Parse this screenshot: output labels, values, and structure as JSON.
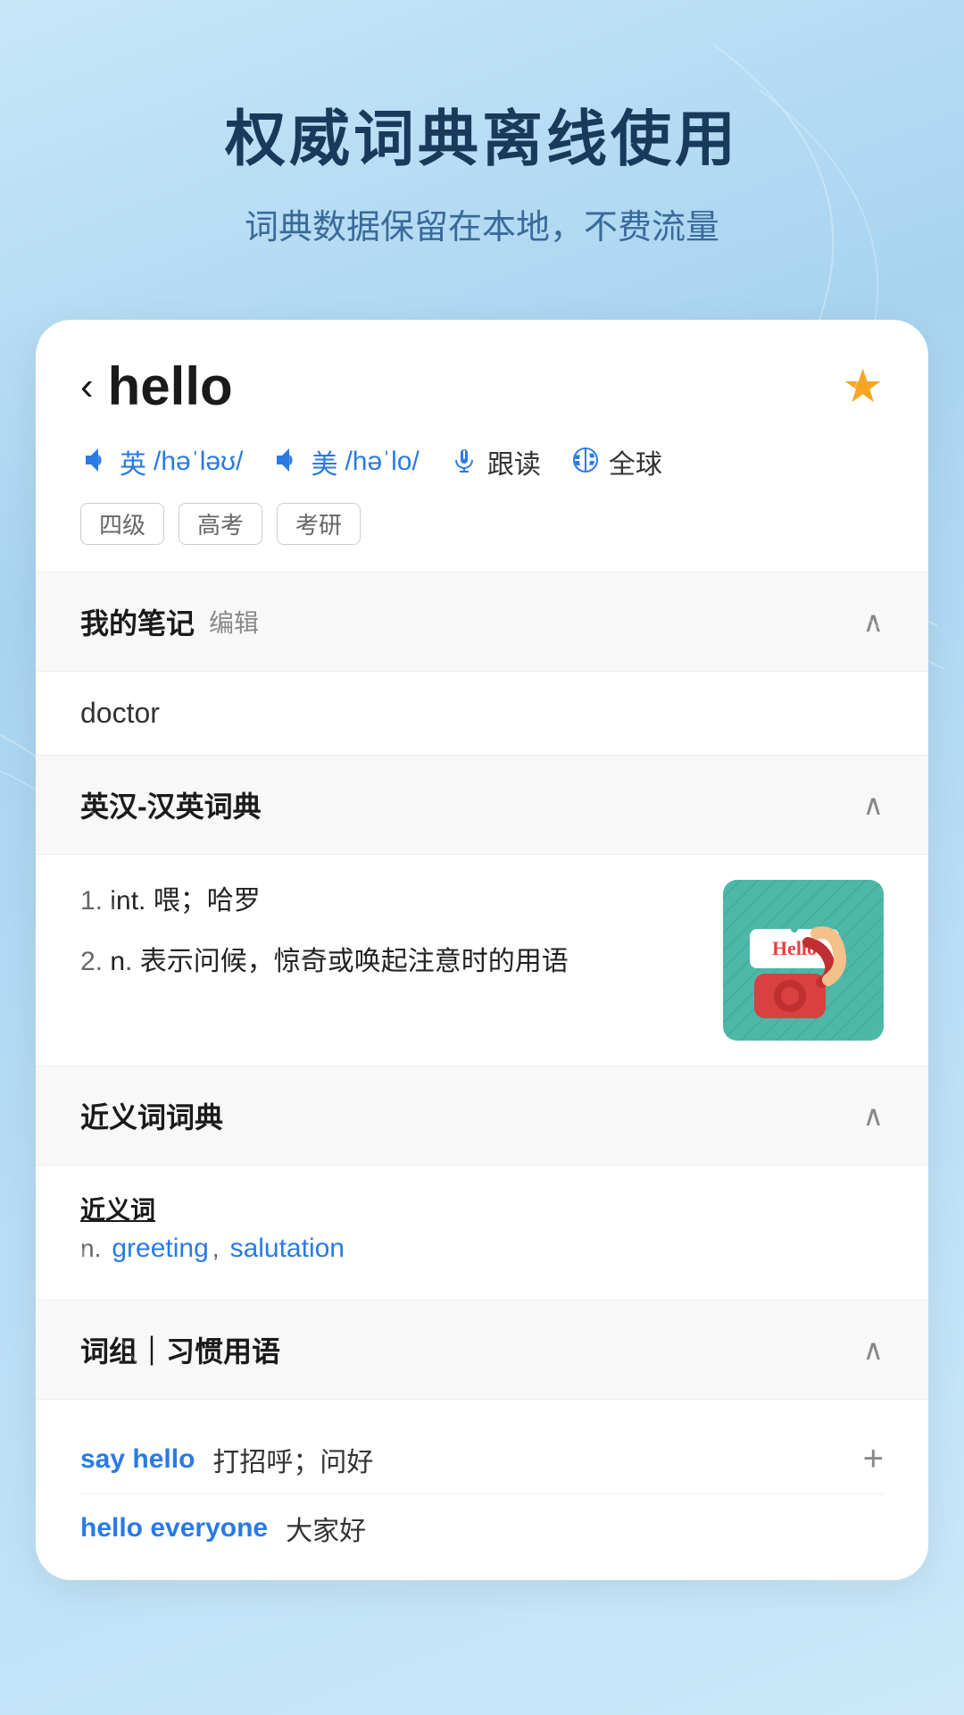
{
  "background": {
    "color": "#b8ddf5"
  },
  "top_section": {
    "main_title": "权威词典离线使用",
    "sub_title": "词典数据保留在本地，不费流量"
  },
  "word_header": {
    "back_arrow": "‹",
    "word": "hello",
    "star_icon": "★",
    "pronunciations": [
      {
        "region": "英",
        "phonetic": "/həˈləʊ/"
      },
      {
        "region": "美",
        "phonetic": "/həˈlo/"
      }
    ],
    "follow_read_label": "跟读",
    "global_label": "全球",
    "tags": [
      "四级",
      "高考",
      "考研"
    ]
  },
  "notes_section": {
    "title": "我的笔记",
    "edit_label": "编辑",
    "content": "doctor",
    "chevron": "∧"
  },
  "dictionary_section": {
    "title": "英汉-汉英词典",
    "chevron": "∧",
    "definitions": [
      {
        "number": "1.",
        "pos": "int.",
        "text": "喂；哈罗"
      },
      {
        "number": "2.",
        "pos": "n.",
        "text": "表示问候，惊奇或唤起注意时的用语"
      }
    ]
  },
  "synonym_section": {
    "title": "近义词词典",
    "chevron": "∧",
    "pos_label": "近义词",
    "part_of_speech": "n.",
    "synonyms": [
      "greeting",
      "salutation"
    ]
  },
  "phrase_section": {
    "title": "词组｜习惯用语",
    "chevron": "∧",
    "phrases": [
      {
        "en": "say hello",
        "zh": "打招呼；问好"
      },
      {
        "en": "hello everyone",
        "zh": "大家好"
      }
    ]
  },
  "icons": {
    "speaker": "🔊",
    "mic": "🎤",
    "global": "🔄",
    "plus": "+",
    "back": "‹",
    "star": "★"
  }
}
